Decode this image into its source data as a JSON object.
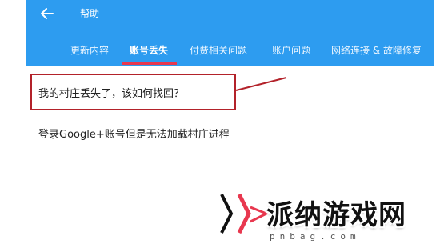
{
  "appbar": {
    "title": "帮助",
    "back_icon": "arrow-left-icon",
    "color": "#2d9cf0"
  },
  "tabs": [
    {
      "label": "更新内容",
      "active": false
    },
    {
      "label": "账号丢失",
      "active": true
    },
    {
      "label": "付费相关问题",
      "active": false
    },
    {
      "label": "账户问题",
      "active": false
    },
    {
      "label": "网络连接 & 故障修复",
      "active": false
    }
  ],
  "tab_indicator_color": "#e8384f",
  "faq": [
    {
      "question": "我的村庄丢失了，该如何找回？",
      "highlighted": true
    },
    {
      "question": "登录Google+账号但是无法加载村庄进程",
      "highlighted": false
    }
  ],
  "annotation_color": "#b3222a",
  "watermark": {
    "text": "派纳游戏网",
    "url": "pnbag.com"
  }
}
